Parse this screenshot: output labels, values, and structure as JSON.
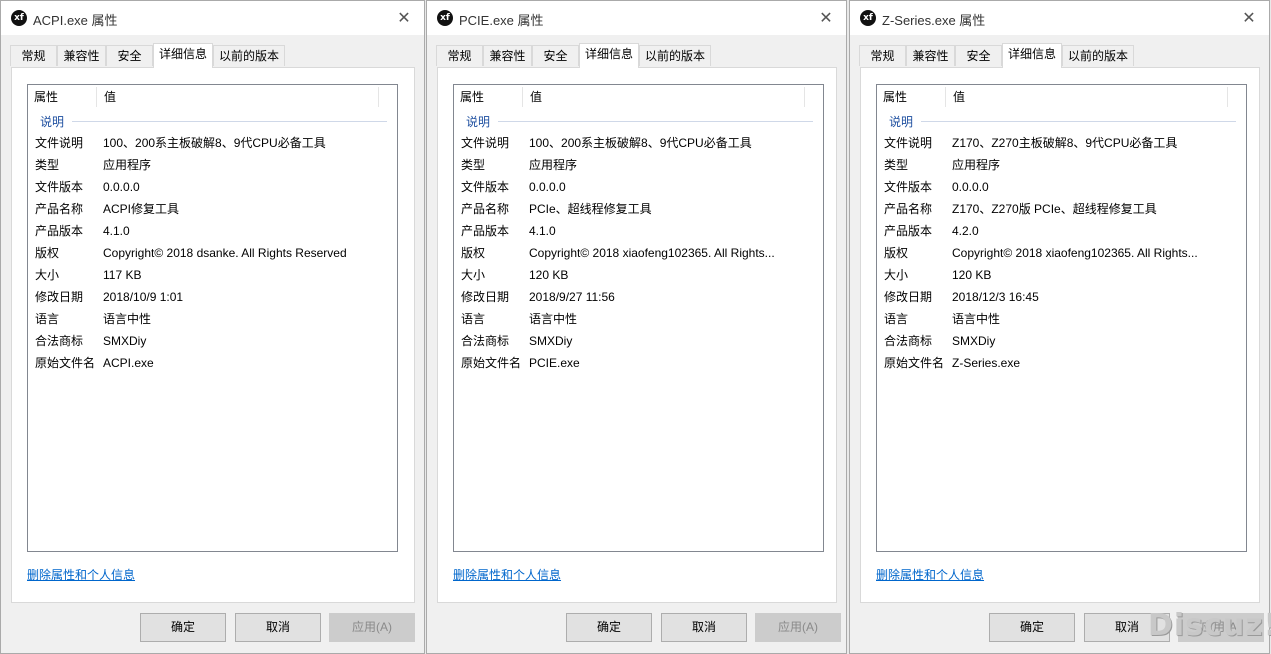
{
  "watermark": "Discuz!",
  "dialogs": [
    {
      "title": "ACPI.exe 属性",
      "tabs": [
        "常规",
        "兼容性",
        "安全",
        "详细信息",
        "以前的版本"
      ],
      "active_tab": "详细信息",
      "columns": {
        "property": "属性",
        "value": "值"
      },
      "group": "说明",
      "rows": [
        {
          "k": "文件说明",
          "v": "100、200系主板破解8、9代CPU必备工具"
        },
        {
          "k": "类型",
          "v": "应用程序"
        },
        {
          "k": "文件版本",
          "v": "0.0.0.0"
        },
        {
          "k": "产品名称",
          "v": "ACPI修复工具"
        },
        {
          "k": "产品版本",
          "v": "4.1.0"
        },
        {
          "k": "版权",
          "v": "Copyright© 2018 dsanke. All Rights Reserved"
        },
        {
          "k": "大小",
          "v": "117 KB"
        },
        {
          "k": "修改日期",
          "v": "2018/10/9 1:01"
        },
        {
          "k": "语言",
          "v": "语言中性"
        },
        {
          "k": "合法商标",
          "v": "SMXDiy"
        },
        {
          "k": "原始文件名",
          "v": "ACPI.exe"
        }
      ],
      "remove_link": "删除属性和个人信息",
      "buttons": {
        "ok": "确定",
        "cancel": "取消",
        "apply": "应用(A)"
      }
    },
    {
      "title": "PCIE.exe 属性",
      "tabs": [
        "常规",
        "兼容性",
        "安全",
        "详细信息",
        "以前的版本"
      ],
      "active_tab": "详细信息",
      "columns": {
        "property": "属性",
        "value": "值"
      },
      "group": "说明",
      "rows": [
        {
          "k": "文件说明",
          "v": "100、200系主板破解8、9代CPU必备工具"
        },
        {
          "k": "类型",
          "v": "应用程序"
        },
        {
          "k": "文件版本",
          "v": "0.0.0.0"
        },
        {
          "k": "产品名称",
          "v": "PCIe、超线程修复工具"
        },
        {
          "k": "产品版本",
          "v": "4.1.0"
        },
        {
          "k": "版权",
          "v": "Copyright© 2018 xiaofeng102365. All Rights..."
        },
        {
          "k": "大小",
          "v": "120 KB"
        },
        {
          "k": "修改日期",
          "v": "2018/9/27 11:56"
        },
        {
          "k": "语言",
          "v": "语言中性"
        },
        {
          "k": "合法商标",
          "v": "SMXDiy"
        },
        {
          "k": "原始文件名",
          "v": "PCIE.exe"
        }
      ],
      "remove_link": "删除属性和个人信息",
      "buttons": {
        "ok": "确定",
        "cancel": "取消",
        "apply": "应用(A)"
      }
    },
    {
      "title": "Z-Series.exe 属性",
      "tabs": [
        "常规",
        "兼容性",
        "安全",
        "详细信息",
        "以前的版本"
      ],
      "active_tab": "详细信息",
      "columns": {
        "property": "属性",
        "value": "值"
      },
      "group": "说明",
      "rows": [
        {
          "k": "文件说明",
          "v": "Z170、Z270主板破解8、9代CPU必备工具"
        },
        {
          "k": "类型",
          "v": "应用程序"
        },
        {
          "k": "文件版本",
          "v": "0.0.0.0"
        },
        {
          "k": "产品名称",
          "v": "Z170、Z270版 PCIe、超线程修复工具"
        },
        {
          "k": "产品版本",
          "v": "4.2.0"
        },
        {
          "k": "版权",
          "v": "Copyright© 2018 xiaofeng102365. All Rights..."
        },
        {
          "k": "大小",
          "v": "120 KB"
        },
        {
          "k": "修改日期",
          "v": "2018/12/3 16:45"
        },
        {
          "k": "语言",
          "v": "语言中性"
        },
        {
          "k": "合法商标",
          "v": "SMXDiy"
        },
        {
          "k": "原始文件名",
          "v": "Z-Series.exe"
        }
      ],
      "remove_link": "删除属性和个人信息",
      "buttons": {
        "ok": "确定",
        "cancel": "取消",
        "apply": "应用(A)"
      }
    }
  ]
}
